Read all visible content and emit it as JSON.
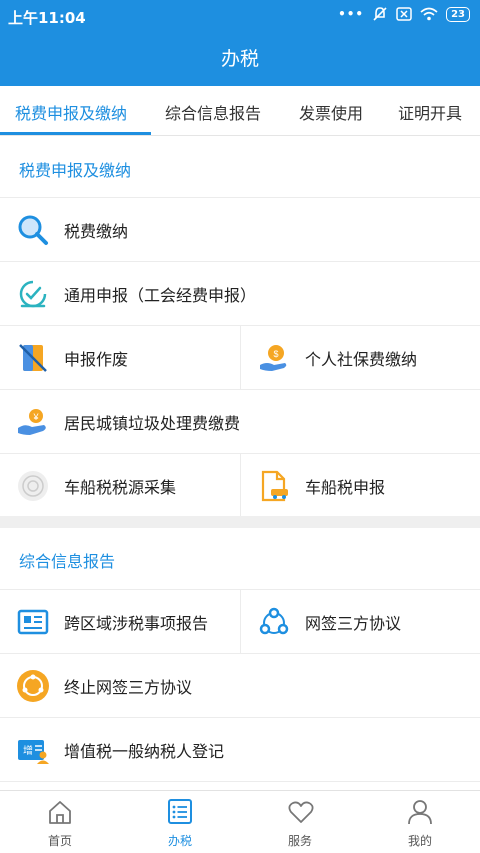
{
  "status_bar": {
    "time": "上午11:04",
    "dots": "•••",
    "battery": "23"
  },
  "header": {
    "title": "办税"
  },
  "tabs": [
    {
      "label": "税费申报及缴纳",
      "active": true
    },
    {
      "label": "综合信息报告",
      "active": false
    },
    {
      "label": "发票使用",
      "active": false
    },
    {
      "label": "证明开具",
      "active": false
    }
  ],
  "sections": [
    {
      "title": "税费申报及缴纳",
      "items": [
        {
          "label": "税费缴纳",
          "icon": "search-icon"
        },
        {
          "label": "通用申报（工会经费申报）",
          "icon": "declaration-icon"
        },
        {
          "label": "申报作废",
          "icon": "void-declaration-icon"
        },
        {
          "label": "个人社保费缴纳",
          "icon": "social-security-icon"
        },
        {
          "label": "居民城镇垃圾处理费缴费",
          "icon": "garbage-fee-icon"
        },
        {
          "label": "车船税税源采集",
          "icon": "vehicle-source-icon"
        },
        {
          "label": "车船税申报",
          "icon": "vehicle-tax-icon"
        }
      ]
    },
    {
      "title": "综合信息报告",
      "items": [
        {
          "label": "跨区域涉税事项报告",
          "icon": "report-icon"
        },
        {
          "label": "网签三方协议",
          "icon": "agreement-icon"
        },
        {
          "label": "终止网签三方协议",
          "icon": "terminate-agreement-icon"
        },
        {
          "label": "增值税一般纳税人登记",
          "icon": "vat-registration-icon"
        }
      ]
    }
  ],
  "bottom_nav": [
    {
      "label": "首页",
      "icon": "home-icon",
      "active": false
    },
    {
      "label": "办税",
      "icon": "tax-list-icon",
      "active": true
    },
    {
      "label": "服务",
      "icon": "heart-icon",
      "active": false
    },
    {
      "label": "我的",
      "icon": "user-icon",
      "active": false
    }
  ],
  "colors": {
    "primary": "#1e8fe0",
    "orange": "#f5a623",
    "divider": "#ececec",
    "gap": "#efefef"
  }
}
